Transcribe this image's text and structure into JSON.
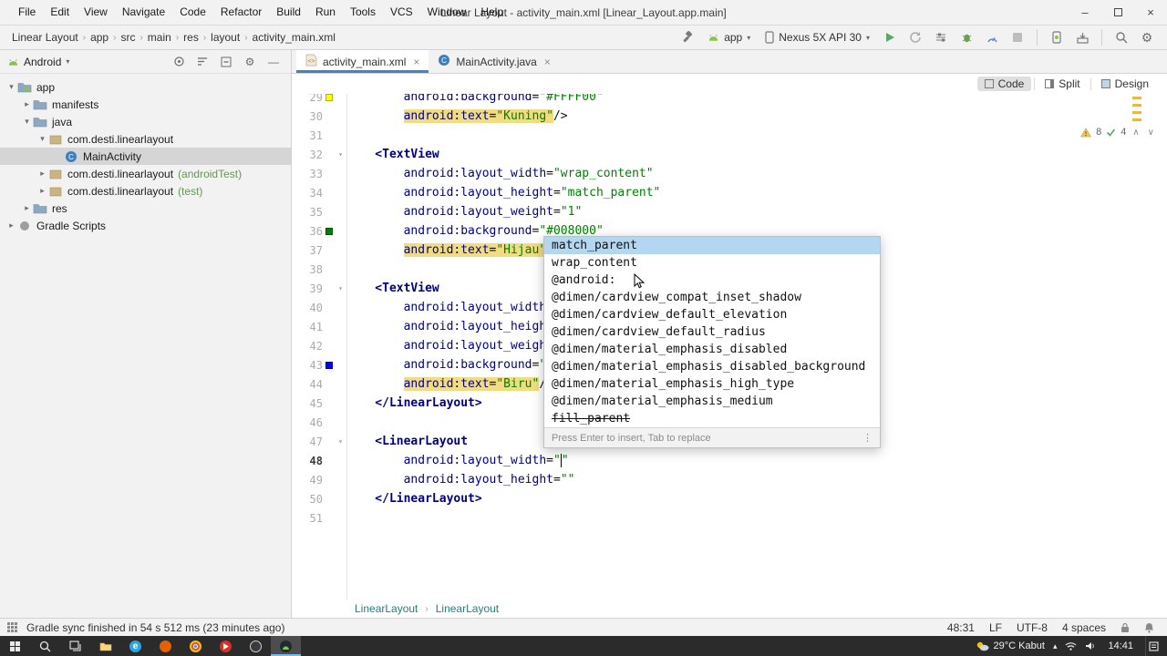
{
  "window": {
    "title": "Linear Layout - activity_main.xml [Linear_Layout.app.main]",
    "menus": [
      "File",
      "Edit",
      "View",
      "Navigate",
      "Code",
      "Refactor",
      "Build",
      "Run",
      "Tools",
      "VCS",
      "Window",
      "Help"
    ]
  },
  "navbar": {
    "breadcrumbs": [
      "Linear Layout",
      "app",
      "src",
      "main",
      "res",
      "layout",
      "activity_main.xml"
    ],
    "run_config": "app",
    "device": "Nexus 5X API 30"
  },
  "project": {
    "selector": "Android",
    "tree": [
      {
        "label": "app",
        "indent": 0,
        "arrow": "down",
        "icon": "folder-app"
      },
      {
        "label": "manifests",
        "indent": 1,
        "arrow": "right",
        "icon": "folder"
      },
      {
        "label": "java",
        "indent": 1,
        "arrow": "down",
        "icon": "folder"
      },
      {
        "label": "com.desti.linearlayout",
        "indent": 2,
        "arrow": "down",
        "icon": "package"
      },
      {
        "label": "MainActivity",
        "indent": 3,
        "arrow": "none",
        "icon": "class",
        "selected": true
      },
      {
        "label": "com.desti.linearlayout",
        "suffix": "(androidTest)",
        "indent": 2,
        "arrow": "right",
        "icon": "package"
      },
      {
        "label": "com.desti.linearlayout",
        "suffix": "(test)",
        "indent": 2,
        "arrow": "right",
        "icon": "package"
      },
      {
        "label": "res",
        "indent": 1,
        "arrow": "right",
        "icon": "folder"
      },
      {
        "label": "Gradle Scripts",
        "indent": 0,
        "arrow": "right",
        "icon": "gradle"
      }
    ]
  },
  "editor": {
    "tabs": [
      {
        "label": "activity_main.xml",
        "icon": "xml",
        "active": true
      },
      {
        "label": "MainActivity.java",
        "icon": "class",
        "active": false
      }
    ],
    "modes": [
      "Code",
      "Split",
      "Design"
    ],
    "active_mode": "Code",
    "inspections": {
      "warnings": "8",
      "passed": "4"
    },
    "breadcrumbs": [
      "LinearLayout",
      "LinearLayout"
    ],
    "code": {
      "lines": [
        {
          "num": 29,
          "indent": 8,
          "swatch": "#FFFF00",
          "tokens": [
            [
              "attr",
              "android:background"
            ],
            [
              "plain",
              "="
            ],
            [
              "value",
              "\"#FFFF00\""
            ]
          ]
        },
        {
          "num": 30,
          "indent": 8,
          "tokens": [
            [
              "attr",
              "android:text",
              1
            ],
            [
              "plain",
              "=",
              1
            ],
            [
              "value",
              "\"Kuning\"",
              1
            ],
            [
              "plain",
              "/>"
            ]
          ]
        },
        {
          "num": 31,
          "indent": 0,
          "tokens": []
        },
        {
          "num": 32,
          "indent": 4,
          "fold": 1,
          "tokens": [
            [
              "tag",
              "<TextView"
            ]
          ]
        },
        {
          "num": 33,
          "indent": 8,
          "tokens": [
            [
              "attr",
              "android:layout_width"
            ],
            [
              "plain",
              "="
            ],
            [
              "value",
              "\"wrap_content\""
            ]
          ]
        },
        {
          "num": 34,
          "indent": 8,
          "tokens": [
            [
              "attr",
              "android:layout_height"
            ],
            [
              "plain",
              "="
            ],
            [
              "value",
              "\"match_parent\""
            ]
          ]
        },
        {
          "num": 35,
          "indent": 8,
          "tokens": [
            [
              "attr",
              "android:layout_weight"
            ],
            [
              "plain",
              "="
            ],
            [
              "value",
              "\"1\""
            ]
          ]
        },
        {
          "num": 36,
          "indent": 8,
          "swatch": "#008000",
          "tokens": [
            [
              "attr",
              "android:background"
            ],
            [
              "plain",
              "="
            ],
            [
              "value",
              "\"#008000\""
            ]
          ]
        },
        {
          "num": 37,
          "indent": 8,
          "tokens": [
            [
              "attr",
              "android:text",
              1
            ],
            [
              "plain",
              "=",
              1
            ],
            [
              "value",
              "\"Hijau\"",
              1
            ],
            [
              "plain",
              "/"
            ]
          ]
        },
        {
          "num": 38,
          "indent": 0,
          "tokens": []
        },
        {
          "num": 39,
          "indent": 4,
          "fold": 1,
          "tokens": [
            [
              "tag",
              "<TextView"
            ]
          ]
        },
        {
          "num": 40,
          "indent": 8,
          "tokens": [
            [
              "attr",
              "android:layout_width"
            ],
            [
              "plain",
              "="
            ]
          ]
        },
        {
          "num": 41,
          "indent": 8,
          "tokens": [
            [
              "attr",
              "android:layout_height"
            ]
          ]
        },
        {
          "num": 42,
          "indent": 8,
          "tokens": [
            [
              "attr",
              "android:layout_weight"
            ]
          ]
        },
        {
          "num": 43,
          "indent": 8,
          "swatch": "#0000FF",
          "tokens": [
            [
              "attr",
              "android:background"
            ],
            [
              "plain",
              "="
            ],
            [
              "value",
              "\"#"
            ]
          ]
        },
        {
          "num": 44,
          "indent": 8,
          "tokens": [
            [
              "attr",
              "android:text",
              1
            ],
            [
              "plain",
              "=",
              1
            ],
            [
              "value",
              "\"Biru\"",
              1
            ],
            [
              "plain",
              "/>"
            ]
          ]
        },
        {
          "num": 45,
          "indent": 4,
          "tokens": [
            [
              "tag",
              "</LinearLayout>"
            ]
          ]
        },
        {
          "num": 46,
          "indent": 0,
          "tokens": []
        },
        {
          "num": 47,
          "indent": 4,
          "fold": 1,
          "tokens": [
            [
              "tag",
              "<LinearLayout"
            ]
          ]
        },
        {
          "num": 48,
          "indent": 8,
          "cur": 1,
          "tokens": [
            [
              "attr",
              "android:layout_width"
            ],
            [
              "plain",
              "="
            ],
            [
              "value",
              "\""
            ],
            [
              "caret",
              ""
            ],
            [
              "value",
              "\""
            ]
          ]
        },
        {
          "num": 49,
          "indent": 8,
          "tokens": [
            [
              "attr",
              "android:layout_height"
            ],
            [
              "plain",
              "="
            ],
            [
              "value",
              "\"\""
            ]
          ]
        },
        {
          "num": 50,
          "indent": 4,
          "tokens": [
            [
              "tag",
              "</LinearLayout>"
            ]
          ]
        },
        {
          "num": 51,
          "indent": 0,
          "tokens": []
        }
      ]
    }
  },
  "completion_popup": {
    "items": [
      {
        "label": "match_parent",
        "selected": true
      },
      {
        "label": "wrap_content"
      },
      {
        "label": "@android:"
      },
      {
        "label": "@dimen/cardview_compat_inset_shadow"
      },
      {
        "label": "@dimen/cardview_default_elevation"
      },
      {
        "label": "@dimen/cardview_default_radius"
      },
      {
        "label": "@dimen/material_emphasis_disabled"
      },
      {
        "label": "@dimen/material_emphasis_disabled_background"
      },
      {
        "label": "@dimen/material_emphasis_high_type"
      },
      {
        "label": "@dimen/material_emphasis_medium"
      },
      {
        "label": "fill_parent",
        "strikethrough": true
      }
    ],
    "hint": "Press Enter to insert, Tab to replace"
  },
  "status_bar": {
    "message": "Gradle sync finished in 54 s 512 ms (23 minutes ago)",
    "position": "48:31",
    "line_ending": "LF",
    "encoding": "UTF-8",
    "indent": "4 spaces"
  },
  "taskbar": {
    "weather": "29°C Kabut",
    "time": "14:41"
  }
}
